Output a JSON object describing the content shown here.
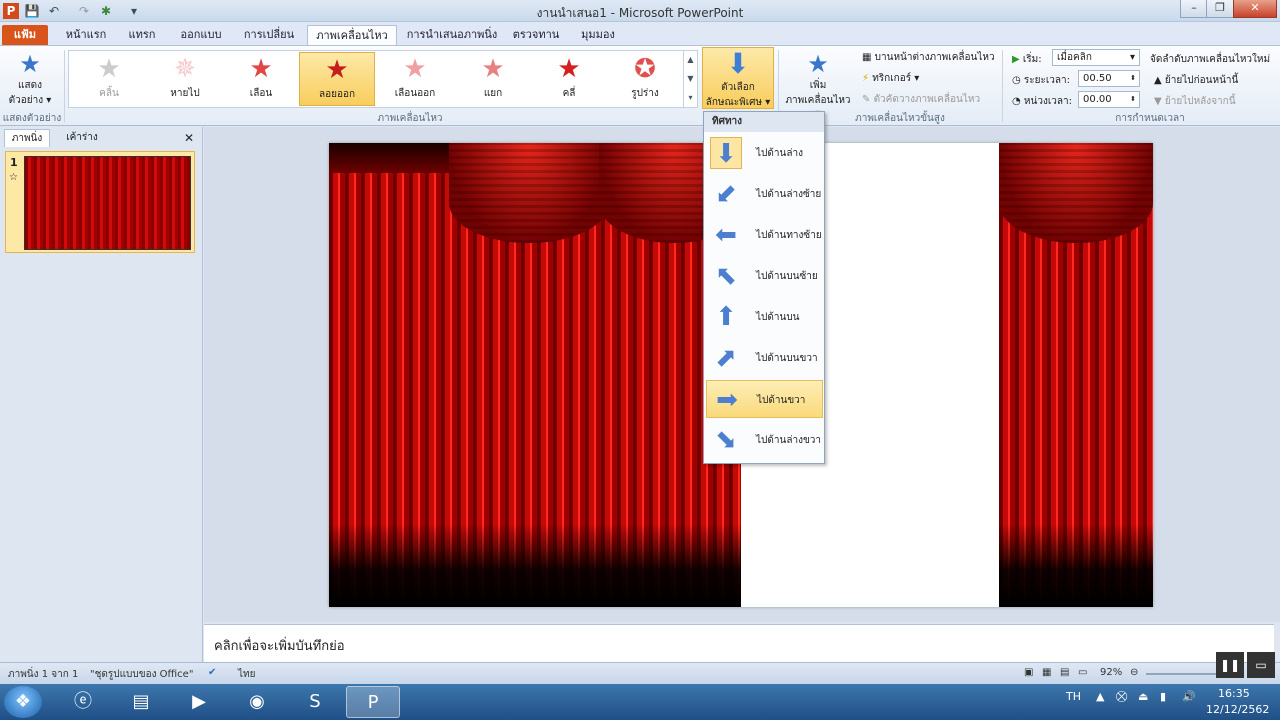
{
  "window": {
    "title": "งานนำเสนอ1 - Microsoft PowerPoint",
    "minimize": "–",
    "maximize": "❐",
    "close": "✕"
  },
  "tabs": [
    "แฟ้ม",
    "หน้าแรก",
    "แทรก",
    "ออกแบบ",
    "การเปลี่ยน",
    "ภาพเคลื่อนไหว",
    "การนำเสนอภาพนิ่ง",
    "ตรวจทาน",
    "มุมมอง"
  ],
  "ribbon": {
    "preview": {
      "label1": "แสดง",
      "label2": "ตัวอย่าง ▾",
      "group": "แสดงตัวอย่าง"
    },
    "animations": [
      "คลิ้น",
      "หายไป",
      "เลือน",
      "ลอยออก",
      "เลือนออก",
      "แยก",
      "คลี่",
      "รูปร่าง"
    ],
    "animations_group": "ภาพเคลื่อนไหว",
    "effect_options": {
      "label1": "ตัวเลือก",
      "label2": "ลักษณะพิเศษ ▾"
    },
    "add_animation": {
      "label1": "เพิ่ม",
      "label2": "ภาพเคลื่อนไหว ▾"
    },
    "advanced": {
      "pane": "บานหน้าต่างภาพเคลื่อนไหว",
      "trigger": "ทริกเกอร์ ▾",
      "painter": "ตัวคัดวางภาพเคลื่อนไหว",
      "group": "ภาพเคลื่อนไหวขั้นสูง"
    },
    "timing": {
      "start_label": "เริ่ม:",
      "start_value": "เมื่อคลิก",
      "duration_label": "ระยะเวลา:",
      "duration_value": "00.50",
      "delay_label": "หน่วงเวลา:",
      "delay_value": "00.00",
      "group": "การกำหนดเวลา"
    },
    "reorder": {
      "title": "จัดลำดับภาพเคลื่อนไหวใหม่",
      "earlier": "ย้ายไปก่อนหน้านี้",
      "later": "ย้ายไปหลังจากนี้"
    }
  },
  "leftpane": {
    "tab_slides": "ภาพนิ่ง",
    "tab_outline": "เค้าร่าง",
    "close": "✕",
    "slide_number": "1"
  },
  "dropdown": {
    "header": "ทิศทาง",
    "items": [
      "ไปด้านล่าง",
      "ไปด้านล่างซ้าย",
      "ไปด้านทางซ้าย",
      "ไปด้านบนซ้าย",
      "ไปด้านบน",
      "ไปด้านบนขวา",
      "ไปด้านขวา",
      "ไปด้านล่างขวา"
    ],
    "arrows": [
      "⬇",
      "⬋",
      "⬅",
      "⬉",
      "⬆",
      "⬈",
      "➡",
      "⬊"
    ]
  },
  "notes": {
    "placeholder": "คลิกเพื่อจะเพิ่มบันทึกย่อ"
  },
  "status": {
    "slide_info": "ภาพนิ่ง 1 จาก 1",
    "theme": "\"ชุดรูปแบบของ Office\"",
    "language": "ไทย",
    "zoom": "92%"
  },
  "taskbar": {
    "lang": "TH",
    "time": "16:35",
    "date": "12/12/2562"
  }
}
